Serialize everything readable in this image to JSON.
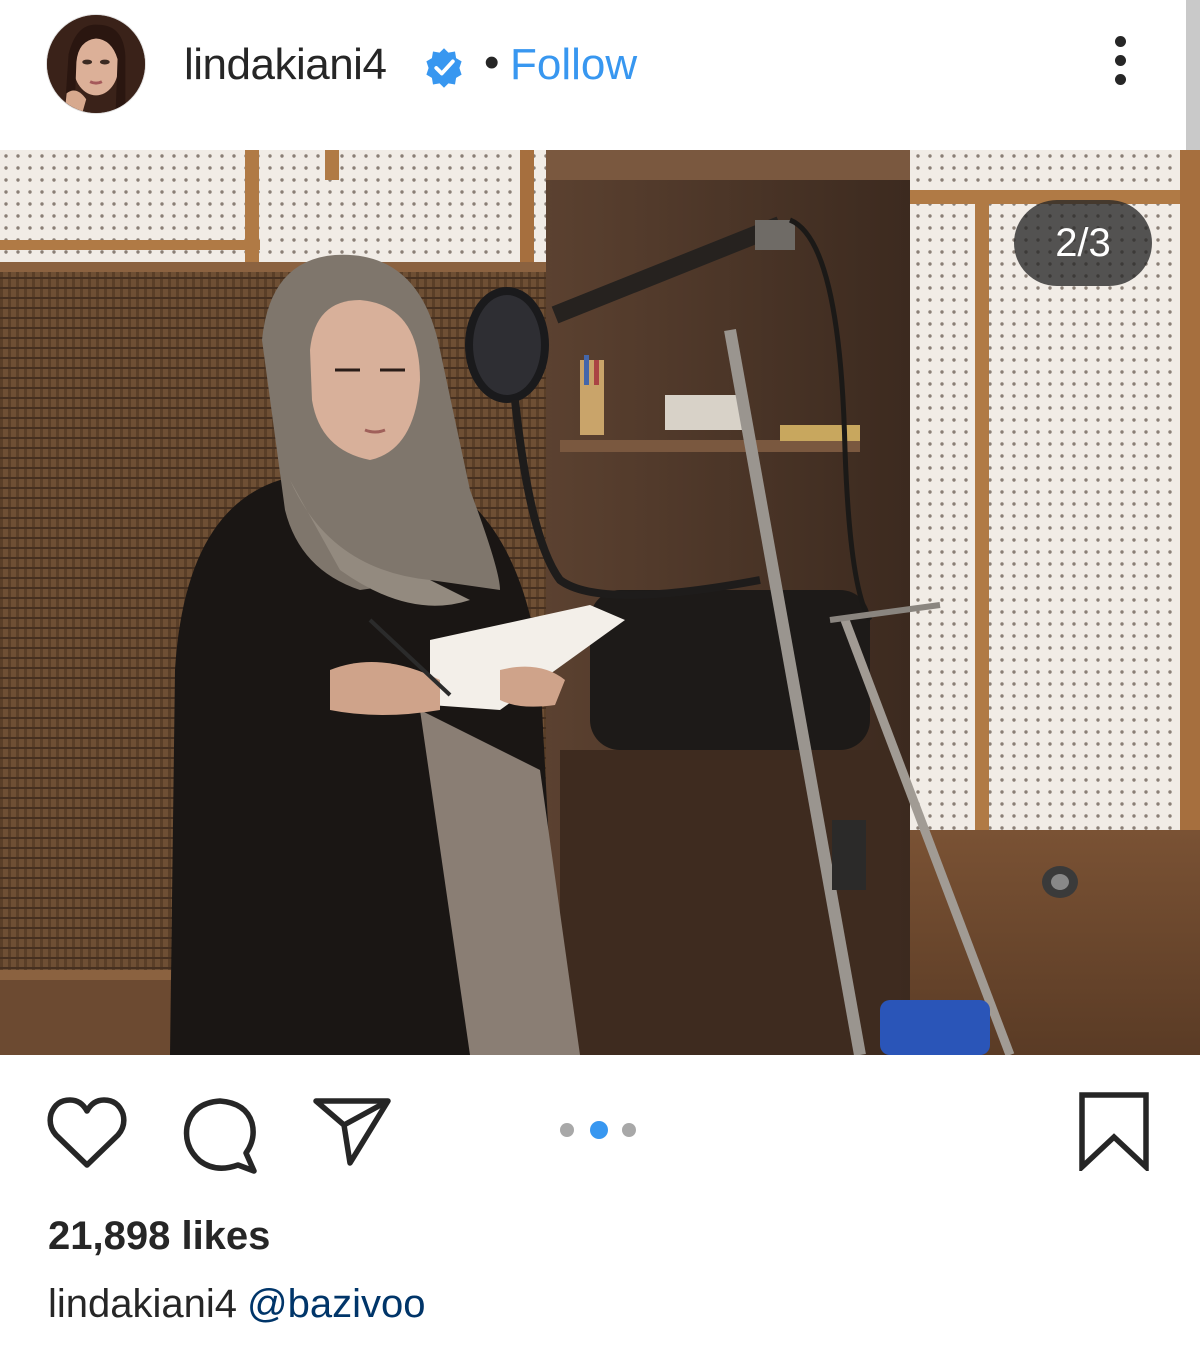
{
  "header": {
    "username": "lindakiani4",
    "separator": "•",
    "follow_label": "Follow",
    "verified_icon": "verified-badge-icon",
    "more_icon": "more-options-icon"
  },
  "media": {
    "counter": "2/3",
    "carousel_total": 3,
    "carousel_active": 2
  },
  "actions": {
    "icons": [
      "heart-icon",
      "comment-icon",
      "share-icon",
      "bookmark-icon"
    ]
  },
  "likes_text": "21,898 likes",
  "caption": {
    "username": "lindakiani4",
    "mention": "@bazivoo"
  },
  "colors": {
    "link_blue": "#3897f0",
    "text": "#262626",
    "mention": "#003569"
  }
}
